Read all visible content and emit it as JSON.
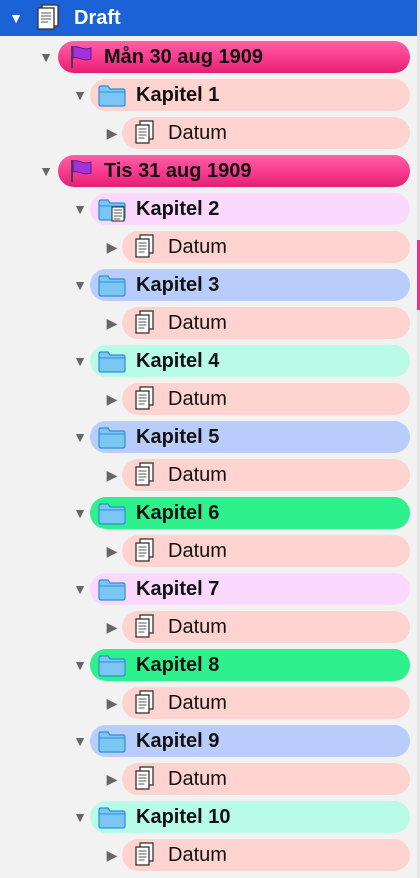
{
  "binder": {
    "root": {
      "label": "Draft",
      "icon": "draft-stack-icon",
      "expanded": true,
      "selected": true
    },
    "items": [
      {
        "level": 1,
        "kind": "flag",
        "label": "Mån 30 aug 1909",
        "color": "#f83a8c",
        "expanded": true
      },
      {
        "level": 2,
        "kind": "folder",
        "label": "Kapitel 1",
        "color": "#ffd3d0",
        "expanded": true
      },
      {
        "level": 3,
        "kind": "doc",
        "label": "Datum",
        "color": "#ffd3d0",
        "expanded": false
      },
      {
        "level": 1,
        "kind": "flag",
        "label": "Tis 31 aug 1909",
        "color": "#f83a8c",
        "expanded": true
      },
      {
        "level": 2,
        "kind": "folder-doc",
        "label": "Kapitel 2",
        "color": "#fbd9ff",
        "expanded": true
      },
      {
        "level": 3,
        "kind": "doc",
        "label": "Datum",
        "color": "#ffd3d0",
        "expanded": false
      },
      {
        "level": 2,
        "kind": "folder",
        "label": "Kapitel 3",
        "color": "#b8cdfb",
        "expanded": true
      },
      {
        "level": 3,
        "kind": "doc",
        "label": "Datum",
        "color": "#ffd3d0",
        "expanded": false
      },
      {
        "level": 2,
        "kind": "folder",
        "label": "Kapitel 4",
        "color": "#b8fbe6",
        "expanded": true
      },
      {
        "level": 3,
        "kind": "doc",
        "label": "Datum",
        "color": "#ffd3d0",
        "expanded": false
      },
      {
        "level": 2,
        "kind": "folder",
        "label": "Kapitel 5",
        "color": "#b8cdfb",
        "expanded": true
      },
      {
        "level": 3,
        "kind": "doc",
        "label": "Datum",
        "color": "#ffd3d0",
        "expanded": false
      },
      {
        "level": 2,
        "kind": "folder",
        "label": "Kapitel 6",
        "color": "#2ef08c",
        "expanded": true
      },
      {
        "level": 3,
        "kind": "doc",
        "label": "Datum",
        "color": "#ffd3d0",
        "expanded": false
      },
      {
        "level": 2,
        "kind": "folder",
        "label": "Kapitel 7",
        "color": "#fbd9ff",
        "expanded": true
      },
      {
        "level": 3,
        "kind": "doc",
        "label": "Datum",
        "color": "#ffd3d0",
        "expanded": false
      },
      {
        "level": 2,
        "kind": "folder",
        "label": "Kapitel 8",
        "color": "#2ef08c",
        "expanded": true
      },
      {
        "level": 3,
        "kind": "doc",
        "label": "Datum",
        "color": "#ffd3d0",
        "expanded": false
      },
      {
        "level": 2,
        "kind": "folder",
        "label": "Kapitel 9",
        "color": "#b8cdfb",
        "expanded": true
      },
      {
        "level": 3,
        "kind": "doc",
        "label": "Datum",
        "color": "#ffd3d0",
        "expanded": false
      },
      {
        "level": 2,
        "kind": "folder",
        "label": "Kapitel 10",
        "color": "#b8fbe6",
        "expanded": true
      },
      {
        "level": 3,
        "kind": "doc",
        "label": "Datum",
        "color": "#ffd3d0",
        "expanded": false
      }
    ]
  },
  "colors": {
    "selection": "#1a62d6",
    "flag": "#a233d8",
    "folder_fill": "#7cc6f4",
    "folder_stroke": "#2d8fd6",
    "disclosure": "#666666"
  },
  "glyphs": {
    "expanded": "▼",
    "collapsed": "▶"
  }
}
